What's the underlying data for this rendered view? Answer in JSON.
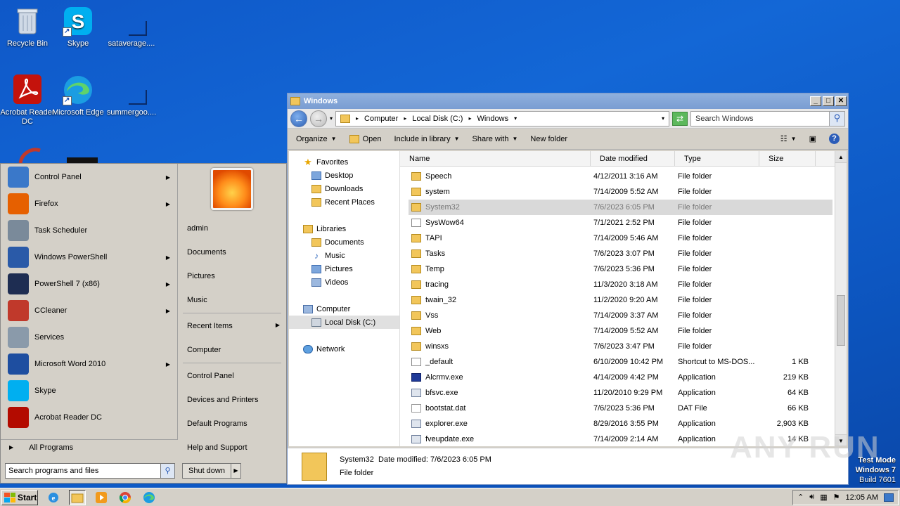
{
  "desktop": {
    "icons": [
      {
        "label": "Recycle Bin"
      },
      {
        "label": "Skype"
      },
      {
        "label": "sataverage...."
      },
      {
        "label": "Acrobat Reader DC"
      },
      {
        "label": "Microsoft Edge"
      },
      {
        "label": "summergoo...."
      }
    ]
  },
  "explorer": {
    "title": "Windows",
    "breadcrumb": [
      "Computer",
      "Local Disk (C:)",
      "Windows"
    ],
    "search_placeholder": "Search Windows",
    "toolbar": {
      "organize": "Organize",
      "open": "Open",
      "include": "Include in library",
      "share": "Share with",
      "new_folder": "New folder"
    },
    "nav": {
      "favorites": "Favorites",
      "desktop": "Desktop",
      "downloads": "Downloads",
      "recent": "Recent Places",
      "libraries": "Libraries",
      "documents": "Documents",
      "music": "Music",
      "pictures": "Pictures",
      "videos": "Videos",
      "computer": "Computer",
      "local_disk": "Local Disk (C:)",
      "network": "Network"
    },
    "columns": {
      "name": "Name",
      "date": "Date modified",
      "type": "Type",
      "size": "Size"
    },
    "files": [
      {
        "name": "Speech",
        "date": "4/12/2011 3:16 AM",
        "type": "File folder",
        "size": "",
        "icon": "folder"
      },
      {
        "name": "system",
        "date": "7/14/2009 5:52 AM",
        "type": "File folder",
        "size": "",
        "icon": "folder"
      },
      {
        "name": "System32",
        "date": "7/6/2023 6:05 PM",
        "type": "File folder",
        "size": "",
        "icon": "folder"
      },
      {
        "name": "SysWow64",
        "date": "7/1/2021 2:52 PM",
        "type": "File folder",
        "size": "",
        "icon": "shortcut"
      },
      {
        "name": "TAPI",
        "date": "7/14/2009 5:46 AM",
        "type": "File folder",
        "size": "",
        "icon": "folder"
      },
      {
        "name": "Tasks",
        "date": "7/6/2023 3:07 PM",
        "type": "File folder",
        "size": "",
        "icon": "folder"
      },
      {
        "name": "Temp",
        "date": "7/6/2023 5:36 PM",
        "type": "File folder",
        "size": "",
        "icon": "folder"
      },
      {
        "name": "tracing",
        "date": "11/3/2020 3:18 AM",
        "type": "File folder",
        "size": "",
        "icon": "folder"
      },
      {
        "name": "twain_32",
        "date": "11/2/2020 9:20 AM",
        "type": "File folder",
        "size": "",
        "icon": "folder"
      },
      {
        "name": "Vss",
        "date": "7/14/2009 3:37 AM",
        "type": "File folder",
        "size": "",
        "icon": "folder"
      },
      {
        "name": "Web",
        "date": "7/14/2009 5:52 AM",
        "type": "File folder",
        "size": "",
        "icon": "folder"
      },
      {
        "name": "winsxs",
        "date": "7/6/2023 3:47 PM",
        "type": "File folder",
        "size": "",
        "icon": "folder"
      },
      {
        "name": "_default",
        "date": "6/10/2009 10:42 PM",
        "type": "Shortcut to MS-DOS...",
        "size": "1 KB",
        "icon": "shortcut"
      },
      {
        "name": "Alcrmv.exe",
        "date": "4/14/2009 4:42 PM",
        "type": "Application",
        "size": "219 KB",
        "icon": "appblue"
      },
      {
        "name": "bfsvc.exe",
        "date": "11/20/2010 9:29 PM",
        "type": "Application",
        "size": "64 KB",
        "icon": "app"
      },
      {
        "name": "bootstat.dat",
        "date": "7/6/2023 5:36 PM",
        "type": "DAT File",
        "size": "66 KB",
        "icon": "file"
      },
      {
        "name": "explorer.exe",
        "date": "8/29/2016 3:55 PM",
        "type": "Application",
        "size": "2,903 KB",
        "icon": "app"
      },
      {
        "name": "fveupdate.exe",
        "date": "7/14/2009 2:14 AM",
        "type": "Application",
        "size": "14 KB",
        "icon": "app"
      }
    ],
    "details": {
      "name": "System32",
      "date_label": "Date modified: 7/6/2023 6:05 PM",
      "type": "File folder"
    }
  },
  "startmenu": {
    "programs": [
      {
        "label": "Control Panel",
        "arrow": true,
        "color": "#3a78c9"
      },
      {
        "label": "Firefox",
        "arrow": true,
        "color": "#e66000"
      },
      {
        "label": "Task Scheduler",
        "arrow": false,
        "color": "#7a8a9a"
      },
      {
        "label": "Windows PowerShell",
        "arrow": true,
        "color": "#2a5aa8"
      },
      {
        "label": "PowerShell 7 (x86)",
        "arrow": true,
        "color": "#1e2d52"
      },
      {
        "label": "CCleaner",
        "arrow": true,
        "color": "#c0392b"
      },
      {
        "label": "Services",
        "arrow": false,
        "color": "#8a9aaa"
      },
      {
        "label": "Microsoft Word 2010",
        "arrow": true,
        "color": "#1e4ea0"
      },
      {
        "label": "Skype",
        "arrow": false,
        "color": "#00aff0"
      },
      {
        "label": "Acrobat Reader DC",
        "arrow": false,
        "color": "#b30b00"
      }
    ],
    "all_programs": "All Programs",
    "search_placeholder": "Search programs and files",
    "right": {
      "user": "admin",
      "documents": "Documents",
      "pictures": "Pictures",
      "music": "Music",
      "recent": "Recent Items",
      "computer": "Computer",
      "control_panel": "Control Panel",
      "devices": "Devices and Printers",
      "default_programs": "Default Programs",
      "help": "Help and Support"
    },
    "shutdown": "Shut down"
  },
  "taskbar": {
    "start": "Start",
    "clock": "12:05 AM"
  },
  "watermark": {
    "line1": "Test Mode",
    "line2": "Windows 7",
    "line3": "Build 7601",
    "brand": "ANY RUN"
  }
}
